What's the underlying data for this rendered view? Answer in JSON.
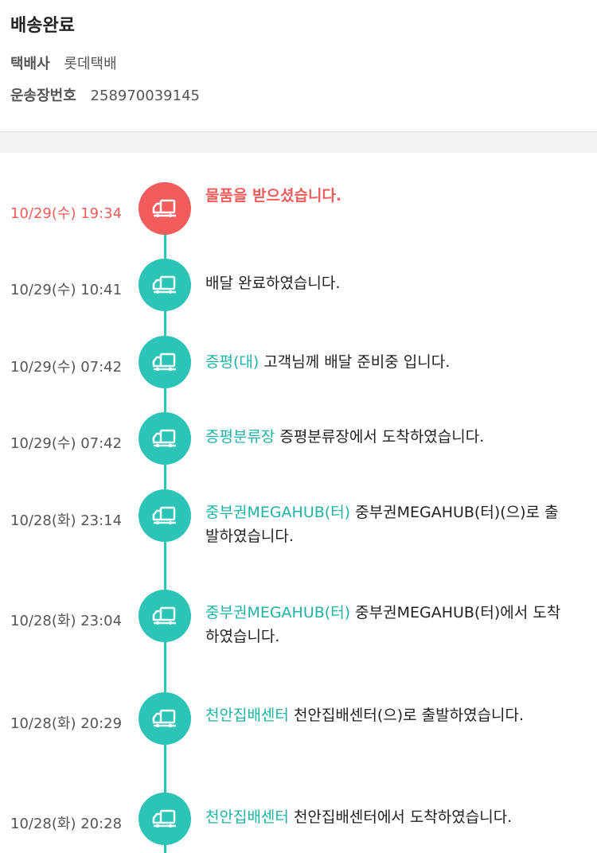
{
  "header": {
    "status": "배송완료",
    "courier_label": "택배사",
    "courier_value": "롯데택배",
    "tracking_label": "운송장번호",
    "tracking_value": "258970039145"
  },
  "colors": {
    "accent_teal": "#2bc4b6",
    "current_red": "#f25c5c"
  },
  "icon": "delivery-truck-icon",
  "events": [
    {
      "time": "10/29(수) 19:34",
      "location": "",
      "message": "물품을 받으셨습니다."
    },
    {
      "time": "10/29(수) 10:41",
      "location": "",
      "message": "배달 완료하였습니다."
    },
    {
      "time": "10/29(수) 07:42",
      "location": "증평(대)",
      "message": "고객님께 배달 준비중 입니다."
    },
    {
      "time": "10/29(수) 07:42",
      "location": "증평분류장",
      "message": "증평분류장에서 도착하였습니다."
    },
    {
      "time": "10/28(화) 23:14",
      "location": "중부권MEGAHUB(터)",
      "message": "중부권MEGAHUB(터)(으)로 출발하였습니다."
    },
    {
      "time": "10/28(화) 23:04",
      "location": "중부권MEGAHUB(터)",
      "message": "중부권MEGAHUB(터)에서 도착하였습니다."
    },
    {
      "time": "10/28(화) 20:29",
      "location": "천안집배센터",
      "message": "천안집배센터(으)로 출발하였습니다."
    },
    {
      "time": "10/28(화) 20:28",
      "location": "천안집배센터",
      "message": "천안집배센터에서 도착하였습니다."
    }
  ]
}
